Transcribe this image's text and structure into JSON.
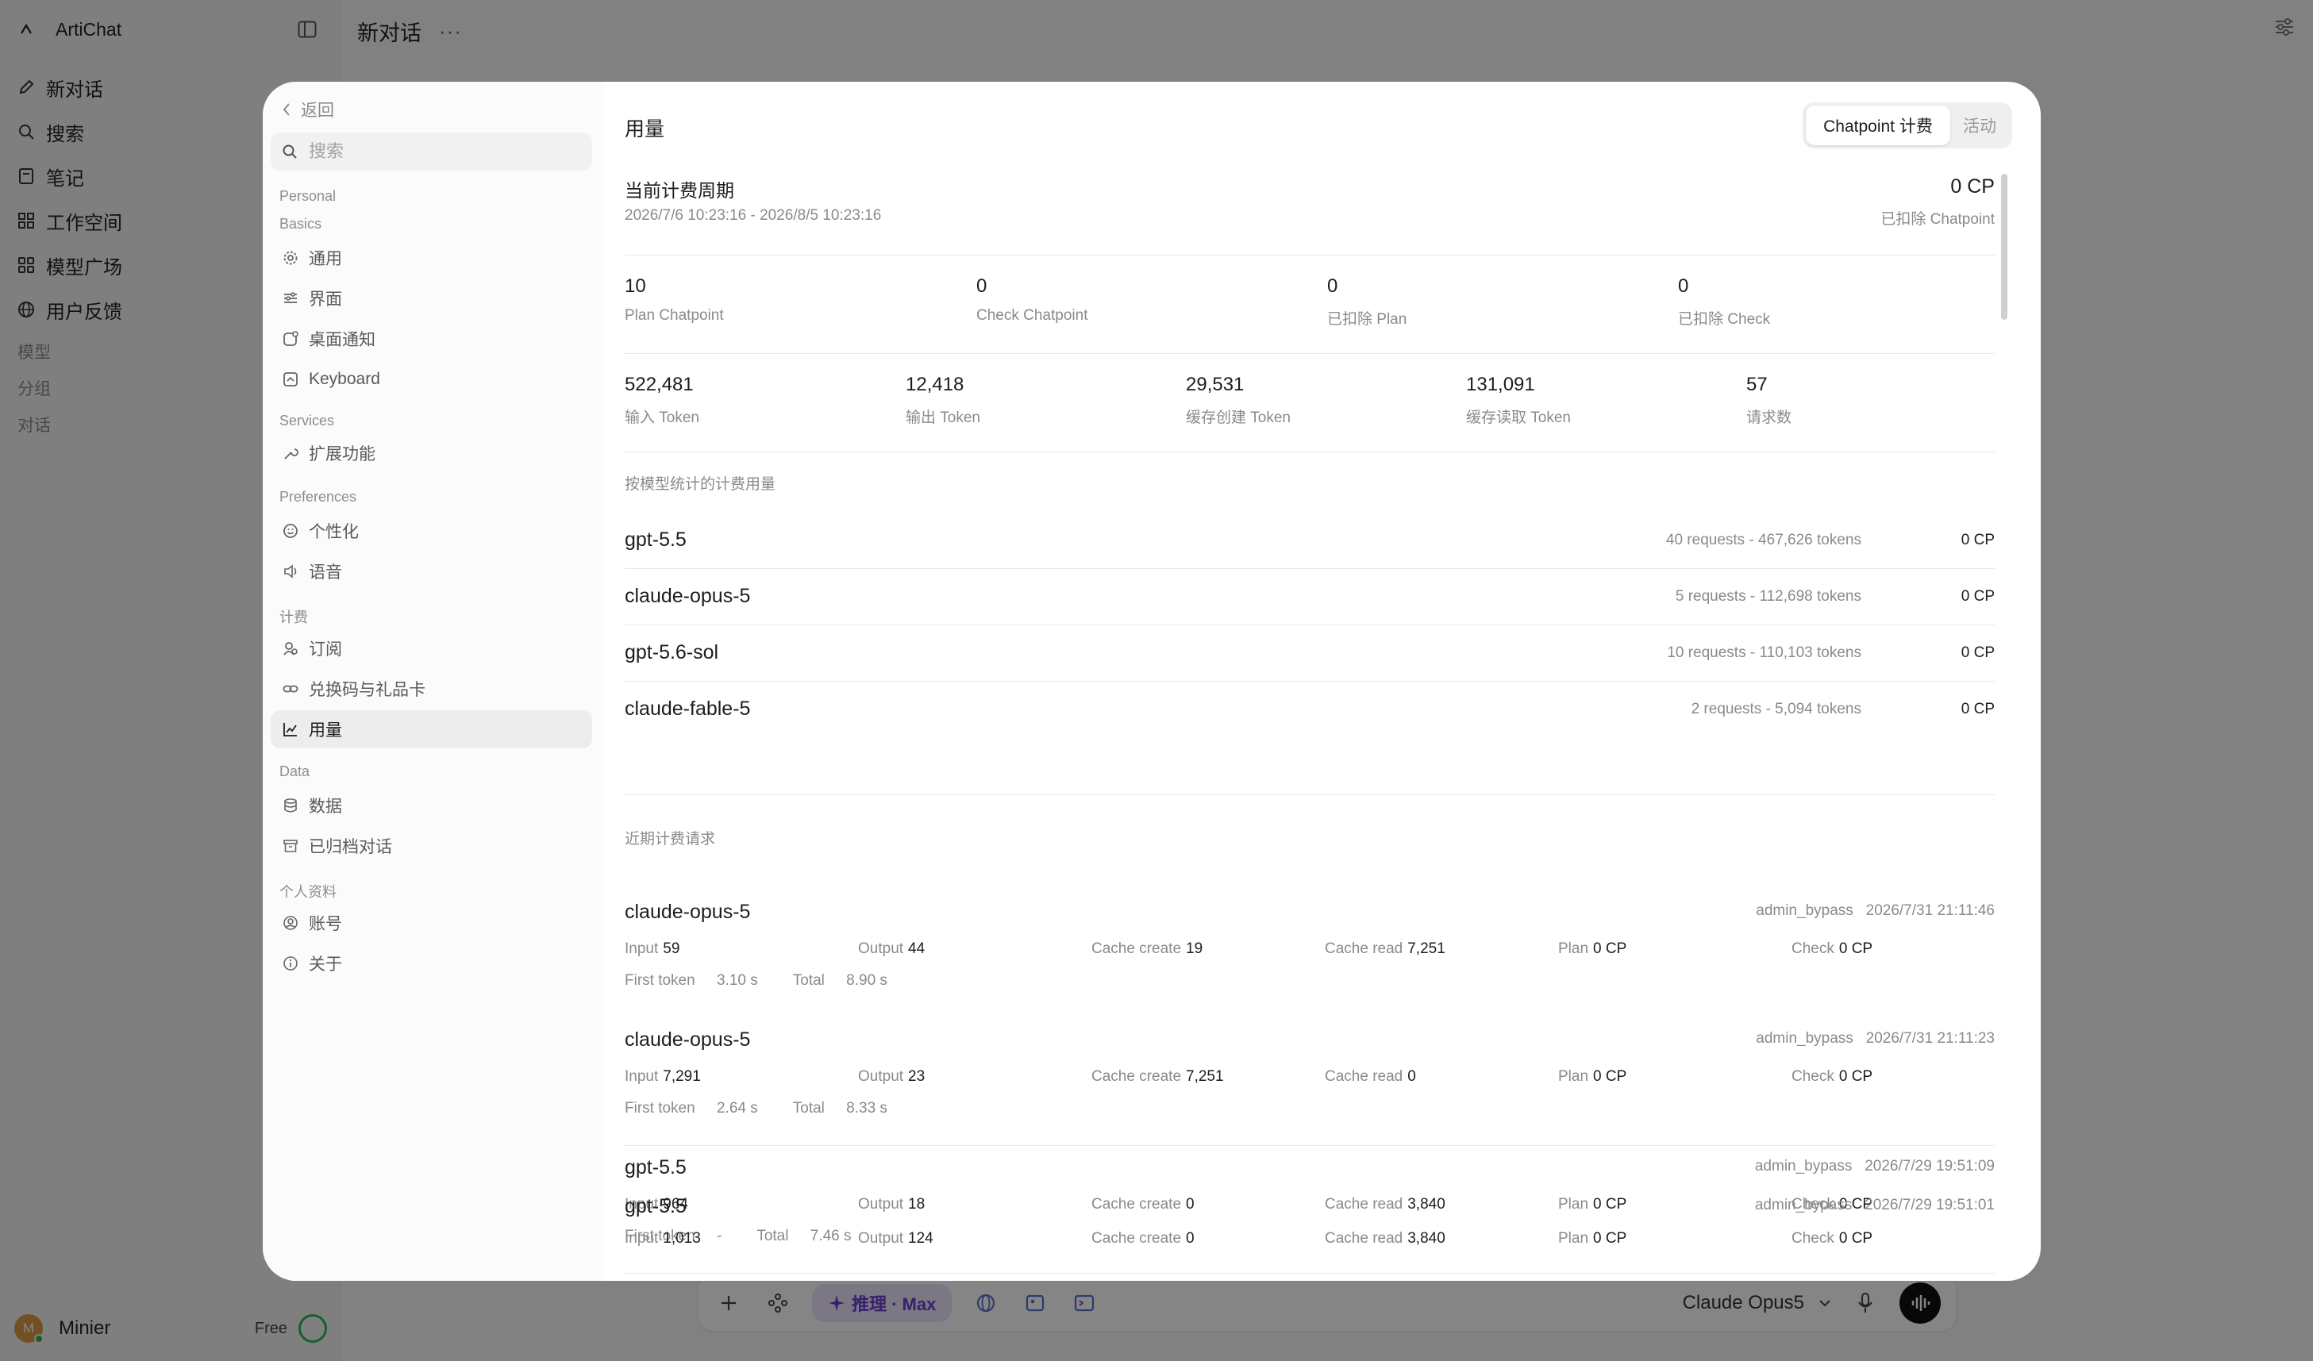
{
  "app": {
    "brand": "ArtiChat",
    "nav": [
      {
        "label": "新对话",
        "icon": "pencil-icon"
      },
      {
        "label": "搜索",
        "icon": "search-icon"
      },
      {
        "label": "笔记",
        "icon": "notes-icon"
      },
      {
        "label": "工作空间",
        "icon": "grid-icon"
      },
      {
        "label": "模型广场",
        "icon": "apps-icon"
      },
      {
        "label": "用户反馈",
        "icon": "globe-icon"
      }
    ],
    "sections": [
      "模型",
      "分组",
      "对话"
    ],
    "user": {
      "name": "Minier",
      "initial": "M",
      "plan": "Free"
    },
    "topbar_title": "新对话",
    "topbar_more": "···",
    "composer": {
      "reason_chip": "推理 · Max",
      "model": "Claude Opus5"
    }
  },
  "settings": {
    "back_label": "返回",
    "search_placeholder": "搜索",
    "groups": {
      "personal": "Personal",
      "basics": "Basics",
      "services": "Services",
      "preferences": "Preferences",
      "billing": "计费",
      "data": "Data",
      "profile": "个人资料"
    },
    "items": {
      "general": "通用",
      "interface": "界面",
      "notifications": "桌面通知",
      "keyboard": "Keyboard",
      "extensions": "扩展功能",
      "personalize": "个性化",
      "voice": "语音",
      "subscription": "订阅",
      "redeem": "兑换码与礼品卡",
      "usage": "用量",
      "data": "数据",
      "archived": "已归档对话",
      "account": "账号",
      "about": "关于"
    }
  },
  "usage": {
    "title": "用量",
    "tabs": {
      "billing": "Chatpoint 计费",
      "activity": "活动"
    },
    "period": {
      "label": "当前计费周期",
      "range": "2026/7/6 10:23:16 - 2026/8/5 10:23:16",
      "total": "0 CP",
      "total_label": "已扣除 Chatpoint"
    },
    "points": [
      {
        "value": "10",
        "label": "Plan Chatpoint"
      },
      {
        "value": "0",
        "label": "Check Chatpoint"
      },
      {
        "value": "0",
        "label": "已扣除 Plan"
      },
      {
        "value": "0",
        "label": "已扣除 Check"
      }
    ],
    "tokens": [
      {
        "value": "522,481",
        "label": "输入 Token"
      },
      {
        "value": "12,418",
        "label": "输出 Token"
      },
      {
        "value": "29,531",
        "label": "缓存创建 Token"
      },
      {
        "value": "131,091",
        "label": "缓存读取 Token"
      },
      {
        "value": "57",
        "label": "请求数"
      }
    ],
    "by_model_label": "按模型统计的计费用量",
    "by_model": [
      {
        "name": "gpt-5.5",
        "meta": "40 requests - 467,626 tokens",
        "cp": "0 CP"
      },
      {
        "name": "claude-opus-5",
        "meta": "5 requests - 112,698 tokens",
        "cp": "0 CP"
      },
      {
        "name": "gpt-5.6-sol",
        "meta": "10 requests - 110,103 tokens",
        "cp": "0 CP"
      },
      {
        "name": "claude-fable-5",
        "meta": "2 requests - 5,094 tokens",
        "cp": "0 CP"
      }
    ],
    "recent_label": "近期计费请求",
    "field_labels": {
      "input": "Input",
      "output": "Output",
      "cache_create": "Cache create",
      "cache_read": "Cache read",
      "plan": "Plan",
      "check": "Check",
      "first_token": "First token",
      "total": "Total"
    },
    "requests": [
      {
        "name": "claude-opus-5",
        "user": "admin_bypass",
        "time": "2026/7/31 21:11:46",
        "input": "59",
        "output": "44",
        "cache_create": "19",
        "cache_read": "7,251",
        "plan": "0 CP",
        "check": "0 CP",
        "first_token": "3.10 s",
        "total": "8.90 s"
      },
      {
        "name": "claude-opus-5",
        "user": "admin_bypass",
        "time": "2026/7/31 21:11:23",
        "input": "7,291",
        "output": "23",
        "cache_create": "7,251",
        "cache_read": "0",
        "plan": "0 CP",
        "check": "0 CP",
        "first_token": "2.64 s",
        "total": "8.33 s"
      },
      {
        "name": "gpt-5.5",
        "user": "admin_bypass",
        "time": "2026/7/29 19:51:09",
        "input": "964",
        "output": "18",
        "cache_create": "0",
        "cache_read": "3,840",
        "plan": "0 CP",
        "check": "0 CP",
        "first_token": "-",
        "total": "7.46 s"
      },
      {
        "name": "gpt-5.5",
        "user": "admin_bypass",
        "time": "2026/7/29 19:51:01",
        "input": "1,013",
        "output": "124",
        "cache_create": "0",
        "cache_read": "3,840",
        "plan": "0 CP",
        "check": "0 CP",
        "first_token": "",
        "total": ""
      }
    ]
  }
}
